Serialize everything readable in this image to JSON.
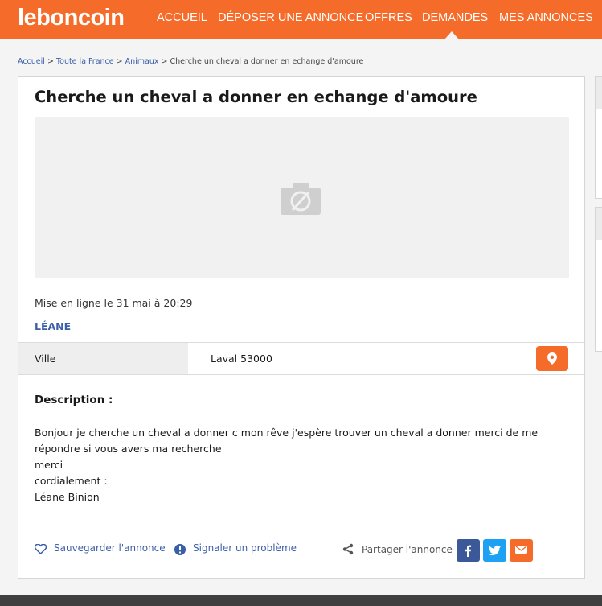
{
  "header": {
    "logo": "leboncoin",
    "nav": [
      {
        "label": "ACCUEIL"
      },
      {
        "label": "DÉPOSER UNE ANNONCE"
      },
      {
        "label": "OFFRES"
      },
      {
        "label": "DEMANDES",
        "active": true
      },
      {
        "label": "MES ANNONCES"
      }
    ],
    "brand_color": "#f56b2a"
  },
  "breadcrumb": [
    {
      "label": "Accueil",
      "link": true
    },
    {
      "label": "Toute la France",
      "link": true
    },
    {
      "label": "Animaux",
      "link": true
    },
    {
      "label": "Cherche un cheval a donner en echange d'amoure",
      "link": false
    }
  ],
  "ad": {
    "title": "Cherche un cheval a donner en echange d'amoure",
    "photo_icon": "no-photo-camera-icon",
    "posted": "Mise en ligne le 31 mai à 20:29",
    "seller": "LÉANE",
    "city_label": "Ville",
    "city_value": "Laval 53000",
    "description_heading": "Description :",
    "description_lines": [
      "Bonjour je cherche un cheval a donner c mon rêve j'espère trouver un cheval a donner merci de me",
      "répondre si vous avers ma recherche",
      "merci",
      "cordialement :",
      "Léane Binion"
    ]
  },
  "actions": {
    "save": "Sauvegarder l'annonce",
    "report": "Signaler un problème",
    "share": "Partager l'annonce",
    "social": [
      {
        "name": "facebook",
        "color": "#3b5998"
      },
      {
        "name": "twitter",
        "color": "#1da1f2"
      },
      {
        "name": "email",
        "color": "#f56b2a"
      }
    ]
  }
}
